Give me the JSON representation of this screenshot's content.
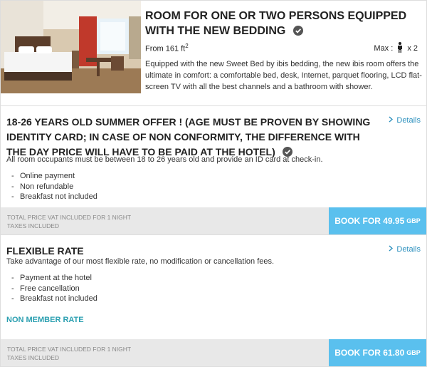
{
  "room": {
    "title": "ROOM FOR ONE OR TWO PERSONS EQUIPPED WITH THE NEW BEDDING",
    "size_prefix": "From 161 ft",
    "size_exp": "2",
    "max_label": "Max :",
    "max_value": "x 2",
    "description": "Equipped with the new Sweet Bed by ibis bedding, the new ibis room offers the ultimate in comfort: a comfortable bed, desk, Internet, parquet flooring, LCD flat-screen TV with all the best channels and a bathroom with shower."
  },
  "offers": [
    {
      "title": "18-26 YEARS OLD SUMMER OFFER ! (AGE MUST BE PROVEN BY SHOWING IDENTITY CARD; IN CASE OF NON CONFORMITY, THE DIFFERENCE WITH THE DAY PRICE WILL HAVE TO BE PAID AT THE HOTEL)",
      "details": "Details",
      "subtitle": "All room occupants must be between 18 to 26 years old and provide an ID card at check-in.",
      "bullets": [
        "Online payment",
        "Non refundable",
        "Breakfast not included"
      ],
      "price_label_1": "TOTAL PRICE VAT INCLUDED FOR 1 NIGHT",
      "price_label_2": "TAXES INCLUDED",
      "book_label": "BOOK FOR 49.95",
      "currency": "GBP"
    },
    {
      "title": "FLEXIBLE RATE",
      "details": "Details",
      "subtitle": "Take advantage of our most flexible rate, no modification or cancellation fees.",
      "bullets": [
        "Payment at the hotel",
        "Free cancellation",
        "Breakfast not included"
      ],
      "member_rate": "NON MEMBER RATE",
      "price_label_1": "TOTAL PRICE VAT INCLUDED FOR 1 NIGHT",
      "price_label_2": "TAXES INCLUDED",
      "book_label": "BOOK FOR 61.80",
      "currency": "GBP"
    }
  ],
  "colors": {
    "accent": "#5ac0ee",
    "link": "#2a8fbd",
    "member_rate": "#2a9fb0",
    "price_bar": "#e8e8e8"
  },
  "icons": [
    "check-circle-icon",
    "person-icon",
    "chevron-right-icon"
  ]
}
